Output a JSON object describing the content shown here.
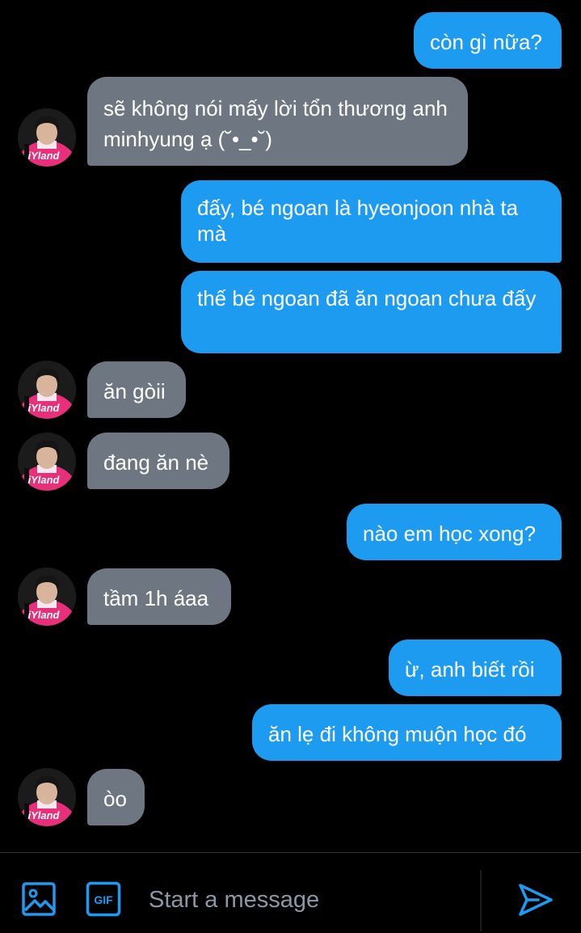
{
  "conversation": {
    "messages": [
      {
        "side": "sent",
        "text": "còn gì nữa?"
      },
      {
        "side": "received",
        "text": "sẽ không nói mấy lời tổn thương anh minhyung ạ (˘•_•˘)"
      },
      {
        "side": "sent",
        "text": "đấy, bé ngoan là hyeonjoon nhà ta mà"
      },
      {
        "side": "sent",
        "text": "thế bé ngoan đã ăn ngoan chưa đấy"
      },
      {
        "side": "received",
        "text": "ăn gòii"
      },
      {
        "side": "received",
        "text": "đang ăn nè"
      },
      {
        "side": "sent",
        "text": "nào em học xong?"
      },
      {
        "side": "received",
        "text": "tầm 1h áaa"
      },
      {
        "side": "sent",
        "text": "ừ, anh biết rồi"
      },
      {
        "side": "sent",
        "text": "ăn lẹ đi không muộn học đó"
      },
      {
        "side": "received",
        "text": "òo"
      }
    ],
    "avatar_jersey_text": "iYland"
  },
  "composer": {
    "placeholder": "Start a message",
    "image_icon": "image-icon",
    "gif_icon": "gif-icon",
    "gif_label": "GIF",
    "send_icon": "send-icon"
  },
  "colors": {
    "background": "#000000",
    "sent_bubble": "#1d9bf0",
    "received_bubble": "#6e7781",
    "accent": "#1d9bf0",
    "placeholder": "#8b98a5"
  }
}
